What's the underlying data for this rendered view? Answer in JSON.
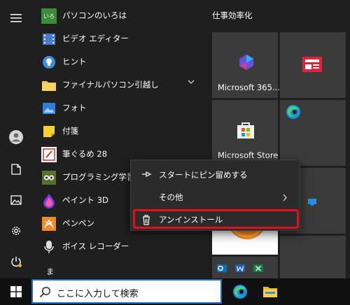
{
  "start_menu": {
    "apps": [
      {
        "label": "パソコンのいろは",
        "icon": "pasokon-iroha-icon"
      },
      {
        "label": "ビデオ エディター",
        "icon": "film-icon"
      },
      {
        "label": "ヒント",
        "icon": "lightbulb-icon"
      },
      {
        "label": "ファイナルパソコン引越し",
        "icon": "folder-icon",
        "expandable": true
      },
      {
        "label": "フォト",
        "icon": "photos-icon"
      },
      {
        "label": "付箋",
        "icon": "sticky-notes-icon"
      },
      {
        "label": "筆ぐるめ 28",
        "icon": "fudegurume-icon"
      },
      {
        "label": "プログラミング学習ゲ…",
        "icon": "programming-game-icon"
      },
      {
        "label": "ペイント 3D",
        "icon": "paint3d-icon"
      },
      {
        "label": "ペンペン",
        "icon": "penpen-icon"
      },
      {
        "label": "ボイス レコーダー",
        "icon": "microphone-icon"
      },
      {
        "label": "ま",
        "icon": ""
      }
    ],
    "tile_group": {
      "title": "仕事効率化",
      "tiles": [
        {
          "label": "Microsoft 365...",
          "icon": "microsoft365-icon"
        },
        {
          "label": "",
          "icon": "news-icon"
        },
        {
          "label": "Microsoft Store",
          "icon": "store-icon"
        },
        {
          "label": "",
          "icon": "edge-icon"
        },
        {
          "label": "",
          "icon": "blue-app-icon"
        }
      ]
    },
    "rail": [
      "hamburger-menu-icon",
      "user-icon",
      "document-icon",
      "pictures-icon",
      "settings-icon",
      "power-icon"
    ]
  },
  "context_menu": {
    "items": [
      {
        "label": "スタートにピン留めする",
        "icon": "pin-icon"
      },
      {
        "label": "その他",
        "icon": "",
        "submenu": true
      },
      {
        "label": "アンインストール",
        "icon": "trash-icon",
        "highlighted": true
      }
    ],
    "highlight_color": "#e0101e"
  },
  "taskbar": {
    "search_placeholder": "ここに入力して検索",
    "apps": [
      "edge-icon",
      "file-explorer-icon"
    ]
  }
}
